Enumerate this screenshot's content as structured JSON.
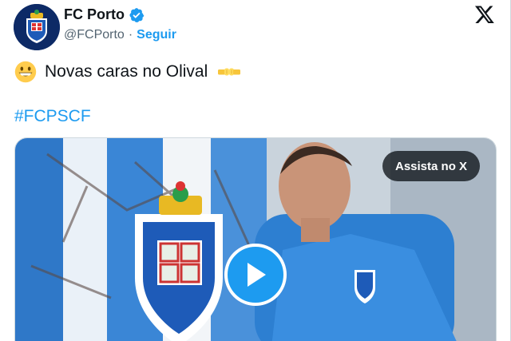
{
  "tweet": {
    "display_name": "FC Porto",
    "handle": "@FCPorto",
    "separator": "·",
    "follow_label": "Seguir",
    "text": "Novas caras no Olival",
    "hashtag": "#FCPSCF",
    "emojis": [
      "grinning-face",
      "fist-bump",
      "fist-bump"
    ]
  },
  "media": {
    "watch_label": "Assista no X",
    "type": "video"
  },
  "colors": {
    "accent": "#1d9bf0",
    "text": "#0f1419",
    "muted": "#536471",
    "club_navy": "#0d2a66"
  }
}
